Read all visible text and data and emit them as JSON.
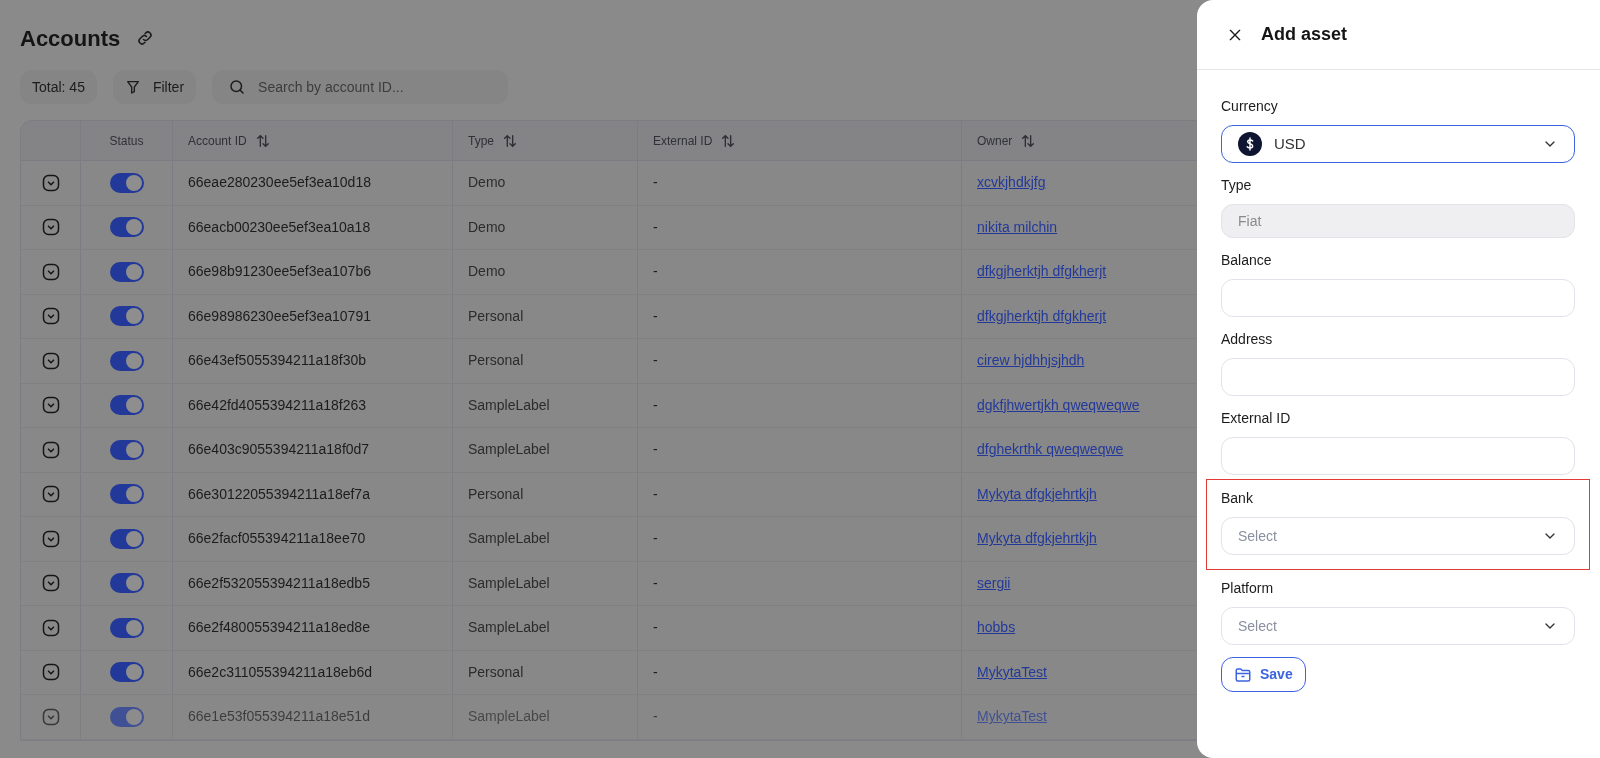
{
  "page": {
    "title": "Accounts",
    "total": "Total: 45",
    "filter": "Filter",
    "search": {
      "placeholder": "Search by account ID..."
    }
  },
  "table": {
    "columns": [
      {
        "label": "Status",
        "sortable": false
      },
      {
        "label": "Account ID",
        "sortable": true
      },
      {
        "label": "Type",
        "sortable": true
      },
      {
        "label": "External ID",
        "sortable": true
      },
      {
        "label": "Owner",
        "sortable": true
      }
    ],
    "rows": [
      {
        "on": true,
        "account_id": "66eae280230ee5ef3ea10d18",
        "type": "Demo",
        "external_id": "-",
        "owner": "xcvkjhdkjfg"
      },
      {
        "on": true,
        "account_id": "66eacb00230ee5ef3ea10a18",
        "type": "Demo",
        "external_id": "-",
        "owner": "nikita milchin"
      },
      {
        "on": true,
        "account_id": "66e98b91230ee5ef3ea107b6",
        "type": "Demo",
        "external_id": "-",
        "owner": "dfkgjherktjh dfgkherjt"
      },
      {
        "on": true,
        "account_id": "66e98986230ee5ef3ea10791",
        "type": "Personal",
        "external_id": "-",
        "owner": "dfkgjherktjh dfgkherjt"
      },
      {
        "on": true,
        "account_id": "66e43ef5055394211a18f30b",
        "type": "Personal",
        "external_id": "-",
        "owner": "cirew hjdhhjsjhdh"
      },
      {
        "on": true,
        "account_id": "66e42fd4055394211a18f263",
        "type": "SampleLabel",
        "external_id": "-",
        "owner": "dgkfjhwertjkh qweqweqwe"
      },
      {
        "on": true,
        "account_id": "66e403c9055394211a18f0d7",
        "type": "SampleLabel",
        "external_id": "-",
        "owner": "dfghekrthk qweqweqwe"
      },
      {
        "on": true,
        "account_id": "66e30122055394211a18ef7a",
        "type": "Personal",
        "external_id": "-",
        "owner": "Mykyta dfgkjehrtkjh"
      },
      {
        "on": true,
        "account_id": "66e2facf055394211a18ee70",
        "type": "SampleLabel",
        "external_id": "-",
        "owner": "Mykyta dfgkjehrtkjh"
      },
      {
        "on": true,
        "account_id": "66e2f532055394211a18edb5",
        "type": "SampleLabel",
        "external_id": "-",
        "owner": "sergii"
      },
      {
        "on": true,
        "account_id": "66e2f480055394211a18ed8e",
        "type": "SampleLabel",
        "external_id": "-",
        "owner": "hobbs"
      },
      {
        "on": true,
        "account_id": "66e2c311055394211a18eb6d",
        "type": "Personal",
        "external_id": "-",
        "owner": "MykytaTest"
      },
      {
        "on": true,
        "account_id": "66e1e53f055394211a18e51d",
        "type": "SampleLabel",
        "external_id": "-",
        "owner": "MykytaTest"
      }
    ]
  },
  "drawer": {
    "title": "Add asset",
    "fields": [
      {
        "kind": "currency",
        "label": "Currency",
        "value": "USD",
        "focused": true,
        "highlighted": false
      },
      {
        "kind": "readonly",
        "label": "Type",
        "value": "Fiat",
        "focused": false,
        "highlighted": false
      },
      {
        "kind": "input",
        "label": "Balance",
        "focused": false,
        "highlighted": false
      },
      {
        "kind": "input",
        "label": "Address",
        "focused": false,
        "highlighted": false
      },
      {
        "kind": "input",
        "label": "External ID",
        "focused": false,
        "highlighted": false
      },
      {
        "kind": "select",
        "label": "Bank",
        "placeholder": "Select",
        "focused": false,
        "highlighted": true
      },
      {
        "kind": "select",
        "label": "Platform",
        "placeholder": "Select",
        "focused": false,
        "highlighted": false
      }
    ],
    "save": "Save"
  }
}
